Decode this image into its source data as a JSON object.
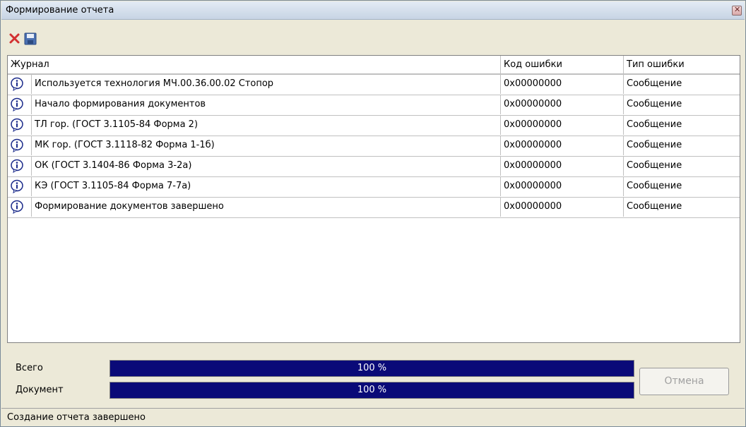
{
  "window": {
    "title": "Формирование отчета"
  },
  "toolbar": {
    "delete_icon": "red-x-icon",
    "save_icon": "floppy-disk-icon"
  },
  "table": {
    "columns": [
      "Журнал",
      "Код ошибки",
      "Тип ошибки"
    ],
    "rows": [
      {
        "icon": "info-icon",
        "journal": "Используется технология МЧ.00.36.00.02 Стопор",
        "code": "0x00000000",
        "type": "Сообщение"
      },
      {
        "icon": "info-icon",
        "journal": "Начало формирования документов",
        "code": "0x00000000",
        "type": "Сообщение"
      },
      {
        "icon": "info-icon",
        "journal": "ТЛ гор. (ГОСТ 3.1105-84 Форма 2)",
        "code": "0x00000000",
        "type": "Сообщение"
      },
      {
        "icon": "info-icon",
        "journal": "МК гор. (ГОСТ 3.1118-82 Форма 1-1б)",
        "code": "0x00000000",
        "type": "Сообщение"
      },
      {
        "icon": "info-icon",
        "journal": "ОК (ГОСТ 3.1404-86 Форма 3-2а)",
        "code": "0x00000000",
        "type": "Сообщение"
      },
      {
        "icon": "info-icon",
        "journal": "КЭ (ГОСТ 3.1105-84 Форма 7-7а)",
        "code": "0x00000000",
        "type": "Сообщение"
      },
      {
        "icon": "info-icon",
        "journal": "Формирование документов завершено",
        "code": "0x00000000",
        "type": "Сообщение"
      }
    ]
  },
  "progress": {
    "total_label": "Всего",
    "total_value": 100,
    "total_text": "100 %",
    "document_label": "Документ",
    "document_value": 100,
    "document_text": "100 %"
  },
  "buttons": {
    "cancel_label": "Отмена"
  },
  "status": {
    "text": "Создание отчета завершено"
  },
  "colors": {
    "progress_fill": "#0a0a78",
    "titlebar": "#d3dfee"
  }
}
